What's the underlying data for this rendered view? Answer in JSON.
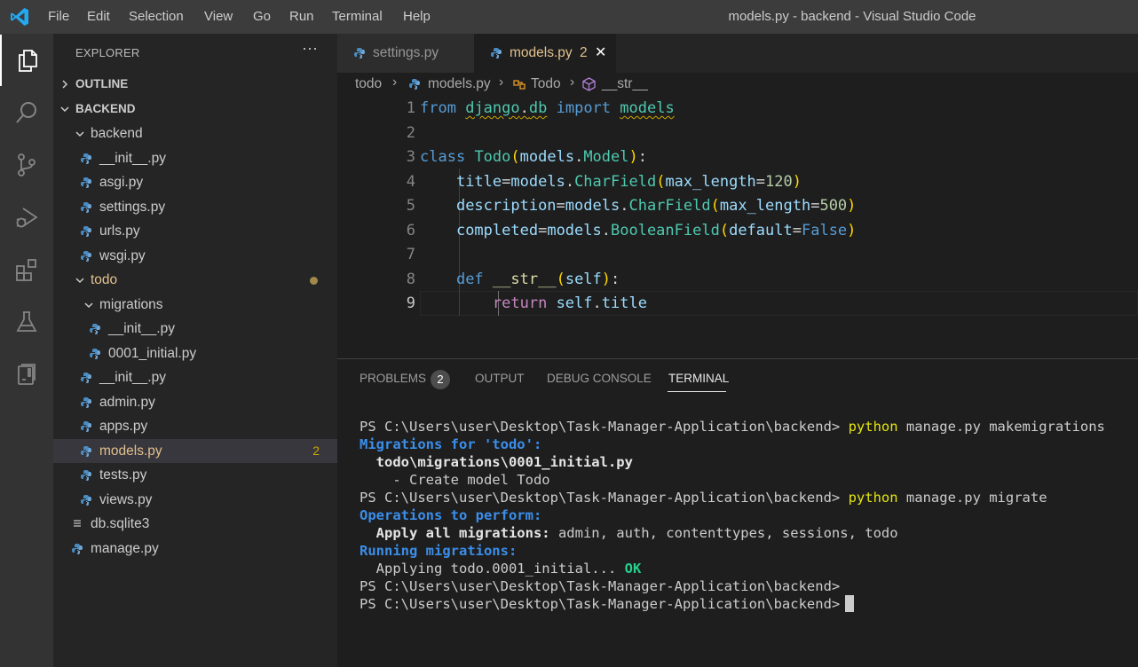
{
  "titlebar": {
    "menu": [
      "File",
      "Edit",
      "Selection",
      "View",
      "Go",
      "Run",
      "Terminal",
      "Help"
    ],
    "window_title": "models.py - backend - Visual Studio Code"
  },
  "activity_bar": {
    "icons": [
      "explorer-icon",
      "search-icon",
      "source-control-icon",
      "run-debug-icon",
      "extensions-icon",
      "testing-icon",
      "remote-explorer-icon"
    ]
  },
  "sidebar": {
    "title": "EXPLORER",
    "more": "···",
    "outline_label": "OUTLINE",
    "backend_label": "BACKEND",
    "items": [
      {
        "label": "backend",
        "kind": "folder"
      },
      {
        "label": "__init__.py",
        "kind": "file"
      },
      {
        "label": "asgi.py",
        "kind": "file"
      },
      {
        "label": "settings.py",
        "kind": "file"
      },
      {
        "label": "urls.py",
        "kind": "file"
      },
      {
        "label": "wsgi.py",
        "kind": "file"
      },
      {
        "label": "todo",
        "kind": "folder"
      },
      {
        "label": "migrations",
        "kind": "folder"
      },
      {
        "label": "__init__.py",
        "kind": "file"
      },
      {
        "label": "0001_initial.py",
        "kind": "file"
      },
      {
        "label": "__init__.py",
        "kind": "file"
      },
      {
        "label": "admin.py",
        "kind": "file"
      },
      {
        "label": "apps.py",
        "kind": "file"
      },
      {
        "label": "models.py",
        "kind": "file",
        "badge": "2"
      },
      {
        "label": "tests.py",
        "kind": "file"
      },
      {
        "label": "views.py",
        "kind": "file"
      },
      {
        "label": "db.sqlite3",
        "kind": "file"
      },
      {
        "label": "manage.py",
        "kind": "file"
      }
    ]
  },
  "tabs": [
    {
      "label": "settings.py"
    },
    {
      "label": "models.py",
      "badge": "2",
      "close": "✕"
    }
  ],
  "breadcrumbs": [
    "todo",
    "models.py",
    "Todo",
    "__str__"
  ],
  "editor": {
    "line_numbers": [
      "1",
      "2",
      "3",
      "4",
      "5",
      "6",
      "7",
      "8",
      "9"
    ],
    "lines": [
      "from django.db import models",
      "",
      "class Todo(models.Model):",
      "    title=models.CharField(max_length=120)",
      "    description=models.CharField(max_length=500)",
      "    completed=models.BooleanField(default=False)",
      "",
      "    def __str__(self):",
      "        return self.title"
    ]
  },
  "panel": {
    "tabs": [
      "PROBLEMS",
      "OUTPUT",
      "DEBUG CONSOLE",
      "TERMINAL"
    ],
    "problems_count": "2",
    "active_tab": "TERMINAL"
  },
  "terminal": {
    "prompt": "PS C:\\Users\\user\\Desktop\\Task-Manager-Application\\backend> ",
    "cmd_keyword": "python",
    "cmd1_rest": " manage.py makemigrations",
    "migrations_for": "Migrations for 'todo':",
    "migration_file": "  todo\\migrations\\0001_initial.py",
    "create_model": "    - Create model Todo",
    "cmd2_rest": " manage.py migrate",
    "operations": "Operations to perform:",
    "apply_all": "  Apply all migrations:",
    "apply_all_rest": " admin, auth, contenttypes, sessions, todo",
    "running": "Running migrations:",
    "applying": "  Applying todo.0001_initial...",
    "ok": " OK",
    "prompt_final": "PS C:\\Users\\user\\Desktop\\Task-Manager-Application\\backend>"
  },
  "colors": {
    "accent": "#007acc",
    "modified": "#e2c08d",
    "warning": "#cca700",
    "terminal_yellow": "#e5e510",
    "terminal_blue": "#3b8eea",
    "terminal_green": "#23d18b"
  }
}
